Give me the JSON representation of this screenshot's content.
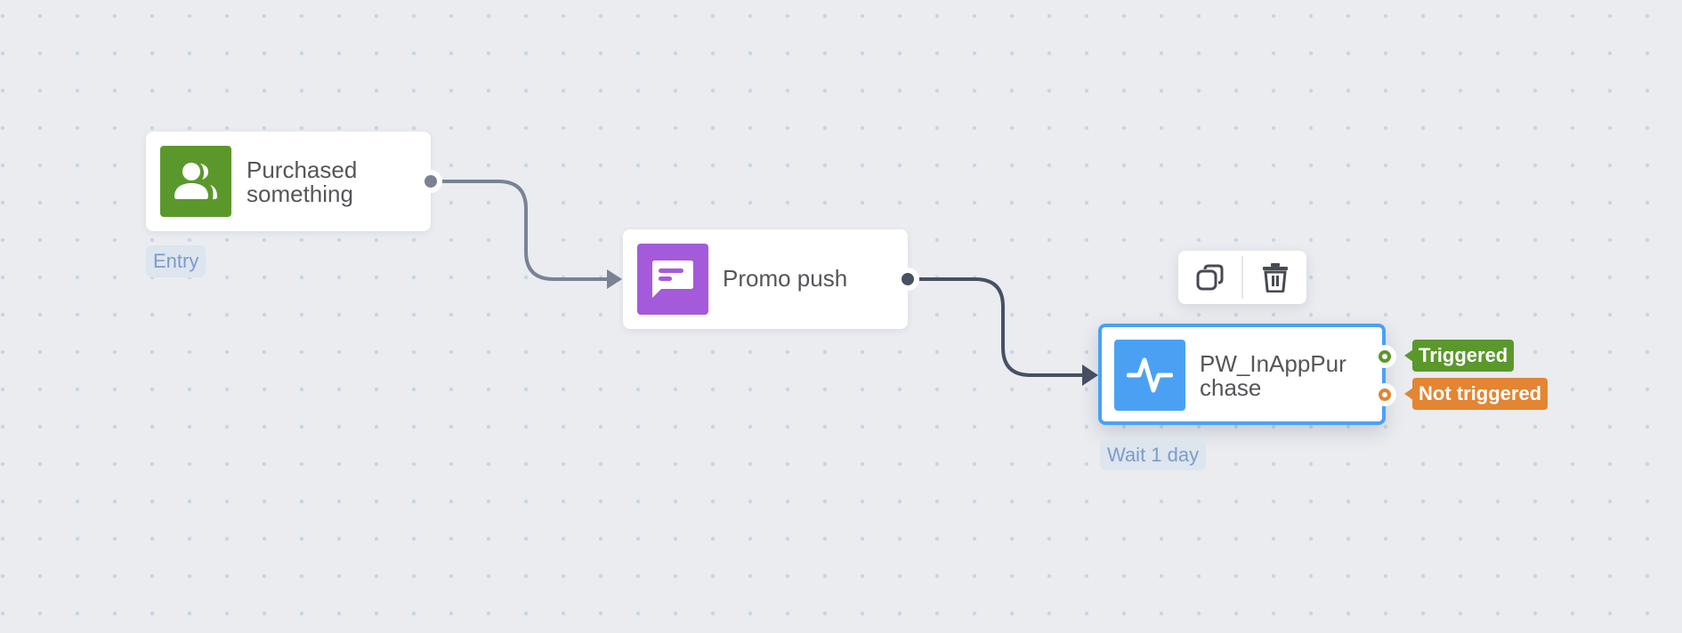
{
  "colors": {
    "trigger_green": "#5b982c",
    "push_purple": "#a55ad9",
    "event_blue": "#4aa1f3",
    "link_gray": "#7a8294",
    "link_dark": "#475064",
    "triggered_green": "#5b982c",
    "not_triggered_orange": "#e38532"
  },
  "nodes": [
    {
      "id": "purchased-something",
      "title": "Purchased\nsomething",
      "icon": "users-icon",
      "subtitle": "Entry"
    },
    {
      "id": "promo-push",
      "title": "Promo push",
      "icon": "message-icon"
    },
    {
      "id": "pw-inapppurchase",
      "title": "PW_InAppPur\nchase",
      "icon": "activity-pulse-icon",
      "subtitle": "Wait 1 day",
      "selected": true,
      "outputs": [
        {
          "label": "Triggered"
        },
        {
          "label": "Not triggered"
        }
      ]
    }
  ],
  "toolbar": {
    "duplicate_icon": "copy-icon",
    "delete_icon": "trash-icon"
  }
}
